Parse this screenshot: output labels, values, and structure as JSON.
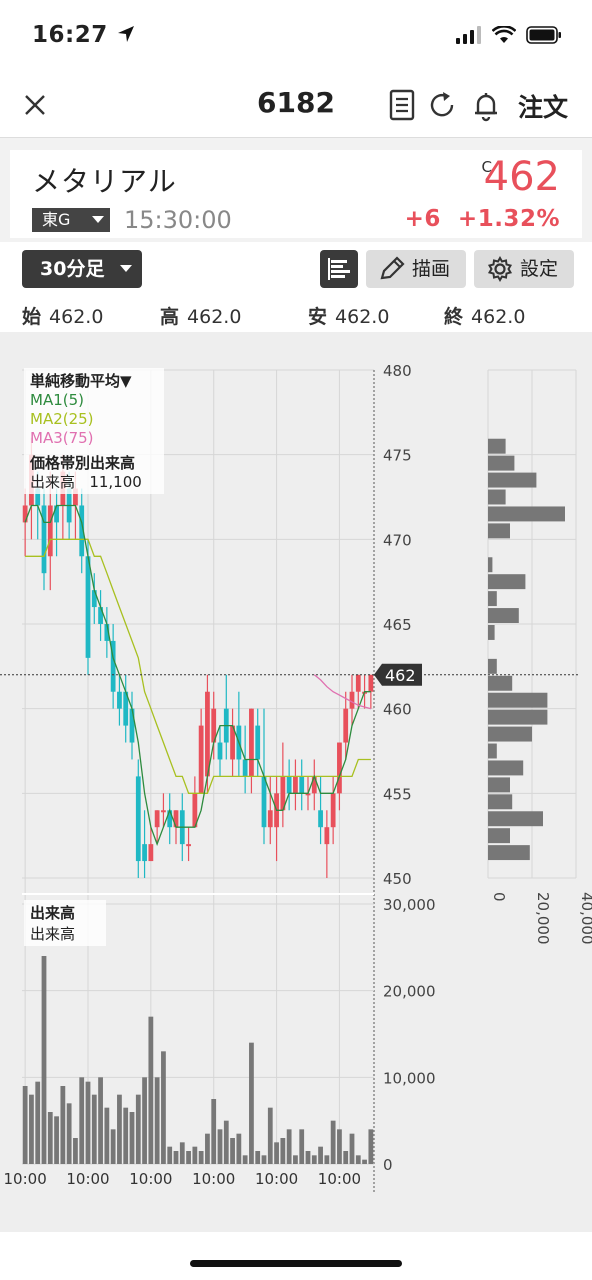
{
  "status": {
    "time": "16:27"
  },
  "nav": {
    "title": "6182",
    "order_label": "注文"
  },
  "stock": {
    "name": "メタリアル",
    "market": "東G",
    "time": "15:30:00",
    "price_prefix": "C",
    "price": "462",
    "change": "+6",
    "change_pct": "+1.32%"
  },
  "toolbar": {
    "timeframe": "30分足",
    "draw_label": "描画",
    "settings_label": "設定"
  },
  "ohlc": {
    "open_label": "始",
    "open": "462.0",
    "high_label": "高",
    "high": "462.0",
    "low_label": "安",
    "low": "462.0",
    "close_label": "終",
    "close": "462.0"
  },
  "legend": {
    "title": "単純移動平均▼",
    "ma1": "MA1(5)",
    "ma2": "MA2(25)",
    "ma3": "MA3(75)",
    "vp_title": "価格帯別出来高",
    "vp_volume_label": "出来高",
    "vp_volume": "11,100"
  },
  "volume_legend": {
    "title": "出来高",
    "sub": "出来高"
  },
  "colors": {
    "up": "#e8505b",
    "down": "#1fb8c4",
    "ma1": "#2e8b3e",
    "ma2": "#a8c020",
    "ma3": "#e070b0",
    "volume": "#777777",
    "price_tag": "#333333"
  },
  "chart_data": {
    "type": "candlestick",
    "price_axis": {
      "min": 450,
      "max": 480,
      "ticks": [
        "480",
        "475",
        "470",
        "465",
        "460",
        "455",
        "450"
      ],
      "tick_values": [
        480,
        475,
        470,
        465,
        460,
        455,
        450
      ]
    },
    "current_price": {
      "value": 462,
      "label": "462"
    },
    "time_ticks": [
      "10:00",
      "10:00",
      "10:00",
      "10:00",
      "10:00",
      "10:00"
    ],
    "time_tick_index": [
      0,
      10,
      20,
      30,
      40,
      50
    ],
    "candles": [
      {
        "o": 471,
        "h": 473,
        "l": 469,
        "c": 472
      },
      {
        "o": 472,
        "h": 476,
        "l": 470,
        "c": 475
      },
      {
        "o": 473,
        "h": 474,
        "l": 470,
        "c": 472
      },
      {
        "o": 472,
        "h": 473,
        "l": 467,
        "c": 468
      },
      {
        "o": 469,
        "h": 474,
        "l": 467,
        "c": 472
      },
      {
        "o": 472,
        "h": 473,
        "l": 469,
        "c": 471
      },
      {
        "o": 472,
        "h": 475,
        "l": 470,
        "c": 474
      },
      {
        "o": 473,
        "h": 474,
        "l": 470,
        "c": 471
      },
      {
        "o": 472,
        "h": 474,
        "l": 470,
        "c": 473
      },
      {
        "o": 472,
        "h": 473,
        "l": 468,
        "c": 469
      },
      {
        "o": 469,
        "h": 470,
        "l": 462,
        "c": 463
      },
      {
        "o": 467,
        "h": 468,
        "l": 465,
        "c": 466
      },
      {
        "o": 466,
        "h": 467,
        "l": 464,
        "c": 465
      },
      {
        "o": 465,
        "h": 466,
        "l": 463,
        "c": 464
      },
      {
        "o": 464,
        "h": 465,
        "l": 460,
        "c": 461
      },
      {
        "o": 461,
        "h": 462,
        "l": 459,
        "c": 460
      },
      {
        "o": 461,
        "h": 462,
        "l": 458,
        "c": 459
      },
      {
        "o": 460,
        "h": 461,
        "l": 457,
        "c": 458
      },
      {
        "o": 456,
        "h": 457,
        "l": 450,
        "c": 451
      },
      {
        "o": 452,
        "h": 454,
        "l": 450,
        "c": 451
      },
      {
        "o": 451,
        "h": 453,
        "l": 451,
        "c": 452
      },
      {
        "o": 453,
        "h": 454,
        "l": 452,
        "c": 454
      },
      {
        "o": 454,
        "h": 455,
        "l": 453,
        "c": 454
      },
      {
        "o": 454,
        "h": 455,
        "l": 452,
        "c": 453
      },
      {
        "o": 453,
        "h": 454,
        "l": 452,
        "c": 454
      },
      {
        "o": 454,
        "h": 455,
        "l": 451,
        "c": 452
      },
      {
        "o": 452,
        "h": 453,
        "l": 451,
        "c": 452
      },
      {
        "o": 453,
        "h": 456,
        "l": 453,
        "c": 455
      },
      {
        "o": 455,
        "h": 460,
        "l": 455,
        "c": 459
      },
      {
        "o": 456,
        "h": 462,
        "l": 455,
        "c": 461
      },
      {
        "o": 458,
        "h": 461,
        "l": 457,
        "c": 460
      },
      {
        "o": 458,
        "h": 459,
        "l": 456,
        "c": 457
      },
      {
        "o": 460,
        "h": 462,
        "l": 457,
        "c": 458
      },
      {
        "o": 457,
        "h": 460,
        "l": 456,
        "c": 459
      },
      {
        "o": 459,
        "h": 461,
        "l": 456,
        "c": 457
      },
      {
        "o": 457,
        "h": 459,
        "l": 455,
        "c": 456
      },
      {
        "o": 456,
        "h": 460,
        "l": 455,
        "c": 460
      },
      {
        "o": 459,
        "h": 460,
        "l": 456,
        "c": 457
      },
      {
        "o": 456,
        "h": 460,
        "l": 452,
        "c": 453
      },
      {
        "o": 453,
        "h": 456,
        "l": 452,
        "c": 454
      },
      {
        "o": 453,
        "h": 456,
        "l": 451,
        "c": 455
      },
      {
        "o": 454,
        "h": 458,
        "l": 453,
        "c": 456
      },
      {
        "o": 456,
        "h": 457,
        "l": 454,
        "c": 455
      },
      {
        "o": 455,
        "h": 457,
        "l": 454,
        "c": 456
      },
      {
        "o": 456,
        "h": 457,
        "l": 454,
        "c": 455
      },
      {
        "o": 455,
        "h": 456,
        "l": 454,
        "c": 455
      },
      {
        "o": 455,
        "h": 457,
        "l": 454,
        "c": 456
      },
      {
        "o": 454,
        "h": 456,
        "l": 452,
        "c": 453
      },
      {
        "o": 452,
        "h": 454,
        "l": 450,
        "c": 453
      },
      {
        "o": 453,
        "h": 456,
        "l": 452,
        "c": 455
      },
      {
        "o": 455,
        "h": 458,
        "l": 454,
        "c": 458
      },
      {
        "o": 458,
        "h": 461,
        "l": 457,
        "c": 460
      },
      {
        "o": 460,
        "h": 462,
        "l": 459,
        "c": 461
      },
      {
        "o": 461,
        "h": 462,
        "l": 460,
        "c": 462
      },
      {
        "o": 461,
        "h": 462,
        "l": 460,
        "c": 461
      },
      {
        "o": 461,
        "h": 462,
        "l": 460,
        "c": 462
      }
    ],
    "ma1": [
      471,
      472,
      472,
      471,
      471,
      472,
      472,
      472,
      472,
      471,
      469,
      467,
      466,
      465,
      463,
      462,
      461,
      460,
      458,
      455,
      453,
      452,
      453,
      454,
      453,
      453,
      453,
      453,
      454,
      456,
      458,
      459,
      459,
      459,
      458,
      457,
      457,
      457,
      456,
      455,
      454,
      454,
      455,
      455,
      455,
      455,
      456,
      455,
      455,
      455,
      456,
      457,
      459,
      460,
      461,
      461
    ],
    "ma2": [
      469,
      469,
      469,
      469,
      470,
      470,
      470,
      470,
      470,
      470,
      470,
      469,
      469,
      468,
      467,
      466,
      465,
      464,
      463,
      461,
      460,
      459,
      458,
      457,
      456,
      456,
      455,
      455,
      455,
      455,
      456,
      456,
      456,
      456,
      456,
      456,
      456,
      456,
      456,
      456,
      456,
      456,
      456,
      456,
      456,
      456,
      456,
      456,
      456,
      456,
      456,
      456,
      456,
      457,
      457,
      457
    ],
    "ma3": [
      null,
      null,
      null,
      null,
      null,
      null,
      null,
      null,
      null,
      null,
      null,
      null,
      null,
      null,
      null,
      null,
      null,
      null,
      null,
      null,
      null,
      null,
      null,
      null,
      null,
      null,
      null,
      null,
      null,
      null,
      null,
      null,
      null,
      null,
      null,
      null,
      null,
      null,
      null,
      null,
      null,
      null,
      null,
      null,
      null,
      null,
      462,
      461.7,
      461.3,
      461,
      460.8,
      460.6,
      460.4,
      460.2,
      460.1,
      460
    ],
    "volume_axis": {
      "min": 0,
      "max": 30000,
      "ticks": [
        "30,000",
        "20,000",
        "10,000",
        "0"
      ],
      "tick_values": [
        30000,
        20000,
        10000,
        0
      ]
    },
    "volume": [
      9000,
      8000,
      9500,
      24000,
      6000,
      5500,
      9000,
      7000,
      3000,
      10000,
      9500,
      8000,
      10000,
      6500,
      4000,
      8000,
      6500,
      6000,
      8000,
      10000,
      17000,
      10000,
      13000,
      2000,
      1500,
      2500,
      1500,
      2000,
      1500,
      3500,
      7500,
      4000,
      5000,
      3000,
      3500,
      1000,
      14000,
      1500,
      1000,
      6500,
      2500,
      3000,
      4000,
      1000,
      4000,
      1500,
      1000,
      2000,
      1000,
      5000,
      4000,
      1500,
      3500,
      1000,
      500,
      4000
    ],
    "volume_profile": {
      "axis_ticks": [
        "0",
        "20,000",
        "40,000"
      ],
      "axis_max": 40000,
      "bins": [
        {
          "price": 475.5,
          "volume": 8000
        },
        {
          "price": 474.5,
          "volume": 12000
        },
        {
          "price": 473.5,
          "volume": 22000
        },
        {
          "price": 472.5,
          "volume": 8000
        },
        {
          "price": 471.5,
          "volume": 35000
        },
        {
          "price": 470.5,
          "volume": 10000
        },
        {
          "price": 468.5,
          "volume": 2000
        },
        {
          "price": 467.5,
          "volume": 17000
        },
        {
          "price": 466.5,
          "volume": 4000
        },
        {
          "price": 465.5,
          "volume": 14000
        },
        {
          "price": 464.5,
          "volume": 3000
        },
        {
          "price": 462.5,
          "volume": 4000
        },
        {
          "price": 461.5,
          "volume": 11000
        },
        {
          "price": 460.5,
          "volume": 27000
        },
        {
          "price": 459.5,
          "volume": 27000
        },
        {
          "price": 458.5,
          "volume": 20000
        },
        {
          "price": 457.5,
          "volume": 4000
        },
        {
          "price": 456.5,
          "volume": 16000
        },
        {
          "price": 455.5,
          "volume": 10000
        },
        {
          "price": 454.5,
          "volume": 11000
        },
        {
          "price": 453.5,
          "volume": 25000
        },
        {
          "price": 452.5,
          "volume": 10000
        },
        {
          "price": 451.5,
          "volume": 19000
        }
      ]
    }
  }
}
